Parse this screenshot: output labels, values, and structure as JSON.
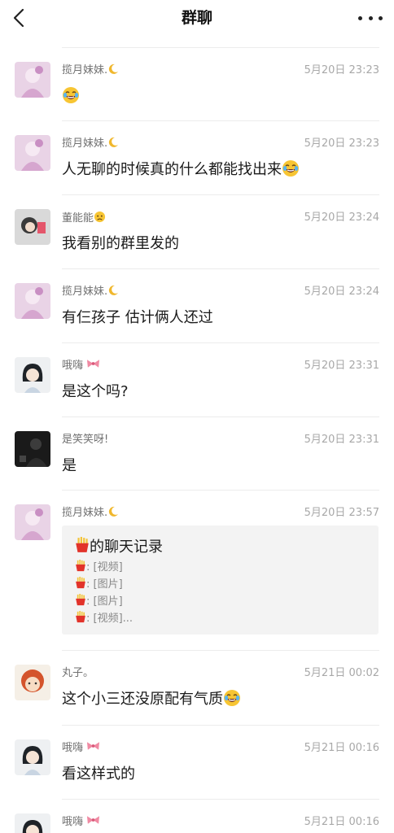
{
  "nav": {
    "title": "群聊",
    "back_icon": "chevron-left-icon",
    "more_icon": "more-dots-icon"
  },
  "messages": [
    {
      "name": "揽月妹妹.",
      "time": "5月20日 23:23",
      "text": ""
    },
    {
      "name": "揽月妹妹.",
      "time": "5月20日 23:23",
      "text": "人无聊的时候真的什么都能找出来"
    },
    {
      "name": "董能能",
      "time": "5月20日 23:24",
      "text": "我看别的群里发的"
    },
    {
      "name": "揽月妹妹.",
      "time": "5月20日 23:24",
      "text": "有仨孩子 估计俩人还过"
    },
    {
      "name": "哦嗨",
      "time": "5月20日 23:31",
      "text": "是这个吗?"
    },
    {
      "name": "是笑笑呀!",
      "time": "5月20日 23:31",
      "text": "是"
    },
    {
      "name": "揽月妹妹.",
      "time": "5月20日 23:57",
      "text": ""
    },
    {
      "name": "丸子。",
      "time": "5月21日 00:02",
      "text": "这个小三还没原配有气质"
    },
    {
      "name": "哦嗨",
      "time": "5月21日 00:16",
      "text": "看这样式的"
    },
    {
      "name": "哦嗨",
      "time": "5月21日 00:16",
      "text": ""
    }
  ],
  "chat_record_card": {
    "title": "的聊天记录",
    "lines": [
      ": [视频]",
      ": [图片]",
      ": [图片]",
      ": [视频]..."
    ]
  },
  "colors": {
    "name_text": "#707070",
    "time_text": "#a8a8a8",
    "card_bg": "#f3f3f3",
    "divider": "#ececec"
  }
}
